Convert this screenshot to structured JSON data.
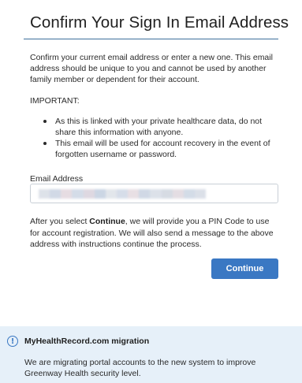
{
  "header": {
    "title": "Confirm Your Sign In Email Address"
  },
  "content": {
    "intro": "Confirm your current email address or enter a new one. This email address should be unique to you and cannot be used by another family member or dependent for their account.",
    "important_label": "IMPORTANT:",
    "bullets": [
      "As this is linked with your private healthcare data, do not share this information with anyone.",
      "This email will be used for account recovery in the event of forgotten username or password."
    ]
  },
  "form": {
    "email_label": "Email Address",
    "email_value_redacted": true,
    "redaction_colors": [
      "#d8dde6",
      "#c9d3e2",
      "#e2d6de",
      "#cdd6e4",
      "#d9d2dc",
      "#c3cfe0",
      "#dde2e8",
      "#d0d8e6",
      "#e4dae0",
      "#c8d2e1",
      "#d6dce6",
      "#cfd5df",
      "#e0d8df",
      "#ccd6e3",
      "#d5dbe5"
    ]
  },
  "after_text": {
    "prefix": "After you select ",
    "emphasis": "Continue",
    "suffix": ", we will provide you a PIN Code to use for account registration. We will also send a message to the above address with instructions continue the process."
  },
  "actions": {
    "continue_label": "Continue",
    "accent_color": "#3a78c3"
  },
  "notice": {
    "icon": "info-icon",
    "icon_glyph": "!",
    "title": "MyHealthRecord.com migration",
    "body": "We are migrating portal accounts to the new system to improve Greenway Health security level."
  }
}
